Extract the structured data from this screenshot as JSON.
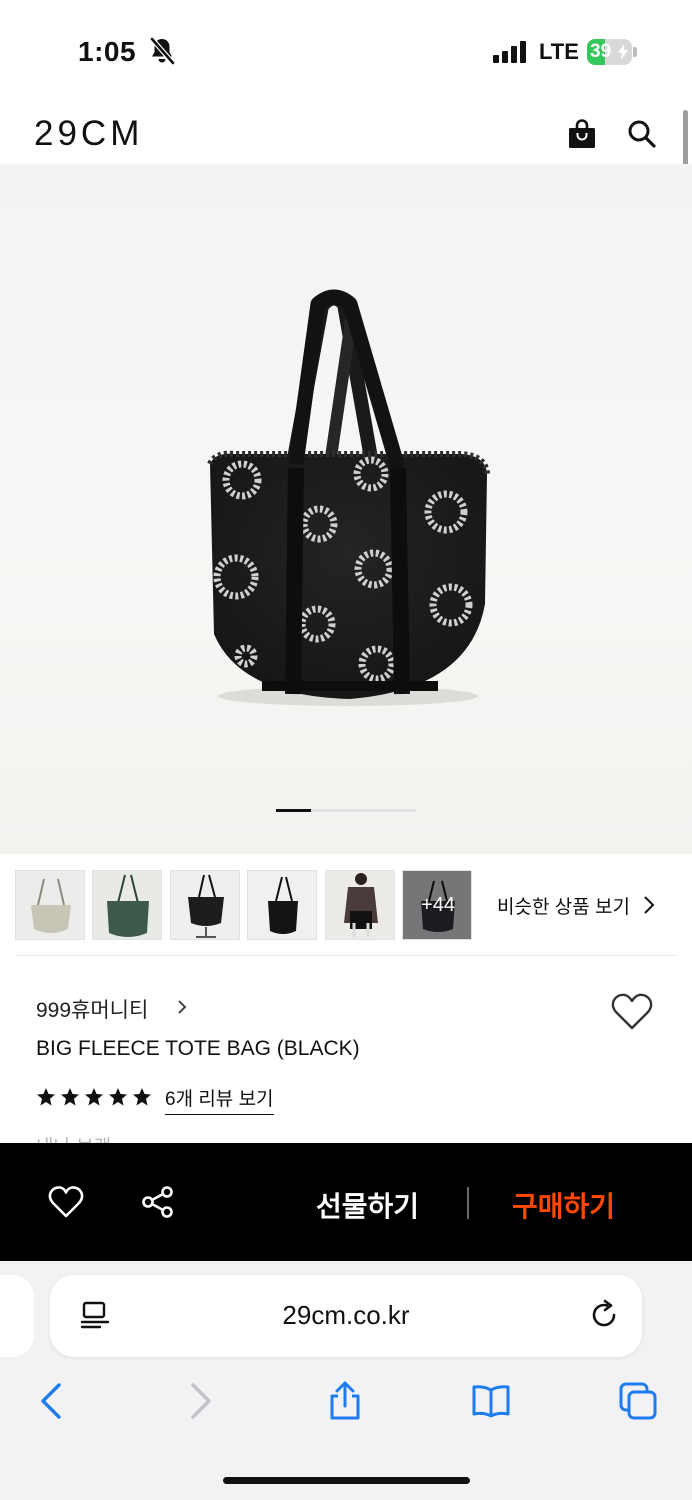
{
  "status_bar": {
    "time": "1:05",
    "network": "LTE",
    "battery_level": "39",
    "battery_fraction": 0.39,
    "icons": [
      "bell-slash-icon",
      "signal-icon",
      "battery-charging-icon"
    ]
  },
  "header": {
    "logo": "29CM",
    "icons": [
      "shopping-bag-icon",
      "search-icon"
    ]
  },
  "product_image": {
    "carousel_position": 1,
    "carousel_fraction": 0.25
  },
  "thumbnails": {
    "items": [
      {
        "name": "thumb-beige-tote",
        "color": "#c7c5b6"
      },
      {
        "name": "thumb-green-tote",
        "color": "#3e5a4c"
      },
      {
        "name": "thumb-black-tote-stand",
        "color": "#1d1d1d"
      },
      {
        "name": "thumb-black-tote",
        "color": "#141414"
      },
      {
        "name": "thumb-model",
        "color": "#4a3c3a"
      },
      {
        "name": "thumb-more",
        "color": "#2a2b30"
      }
    ],
    "more_label": "+44",
    "similar_label": "비슷한 상품 보기"
  },
  "product": {
    "brand": "999휴머니티",
    "title": "BIG FLEECE TOTE BAG (BLACK)",
    "rating_stars": 5,
    "reviews_label": "6개 리뷰 보기",
    "partial_text": "내나 브랜"
  },
  "buy_bar": {
    "gift_label": "선물하기",
    "buy_label": "구매하기",
    "colors": {
      "background": "#000000",
      "buy": "#ff4800"
    }
  },
  "browser": {
    "url": "29cm.co.kr",
    "icons": [
      "reader-icon",
      "reload-icon",
      "back-icon",
      "forward-icon",
      "share-icon",
      "bookmarks-icon",
      "tabs-icon"
    ],
    "accent": "#1e7cf0"
  }
}
